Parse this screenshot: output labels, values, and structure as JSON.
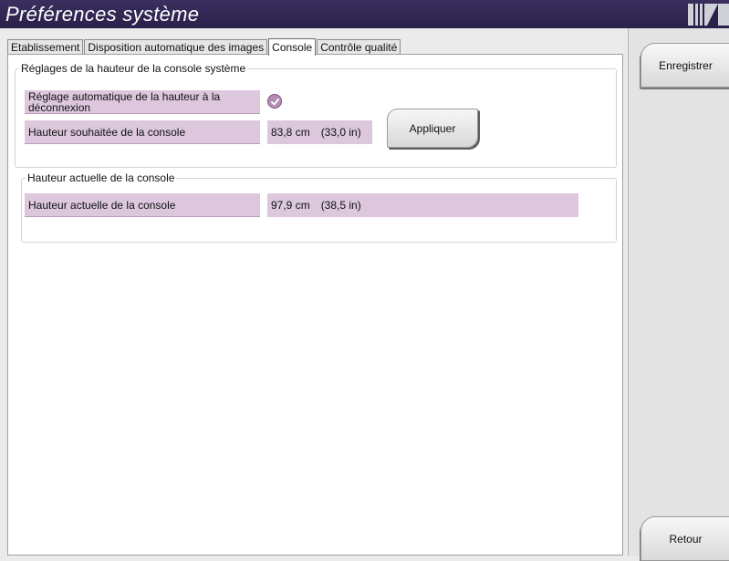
{
  "window": {
    "title": "Préférences système"
  },
  "tabs": [
    {
      "label": "Etablissement",
      "active": false
    },
    {
      "label": "Disposition automatique des images",
      "active": false
    },
    {
      "label": "Console",
      "active": true
    },
    {
      "label": "Contrôle qualité",
      "active": false
    }
  ],
  "height_settings": {
    "group_title": "Réglages de la hauteur de la console système",
    "auto_adjust_label": "Réglage automatique de la hauteur à la déconnexion",
    "auto_adjust_checked": true,
    "desired_height_label": "Hauteur souhaitée de la console",
    "desired_height_cm": "83,8 cm",
    "desired_height_in": "(33,0 in)",
    "apply_label": "Appliquer"
  },
  "current_height": {
    "group_title": "Hauteur actuelle de la console",
    "label": "Hauteur actuelle de la console",
    "value_cm": "97,9 cm",
    "value_in": "(38,5 in)"
  },
  "sidebar": {
    "save_label": "Enregistrer",
    "back_label": "Retour"
  },
  "colors": {
    "title_bar": "#2a214a",
    "field_background": "#dcc7dd",
    "check_accent": "#b48cb4"
  }
}
